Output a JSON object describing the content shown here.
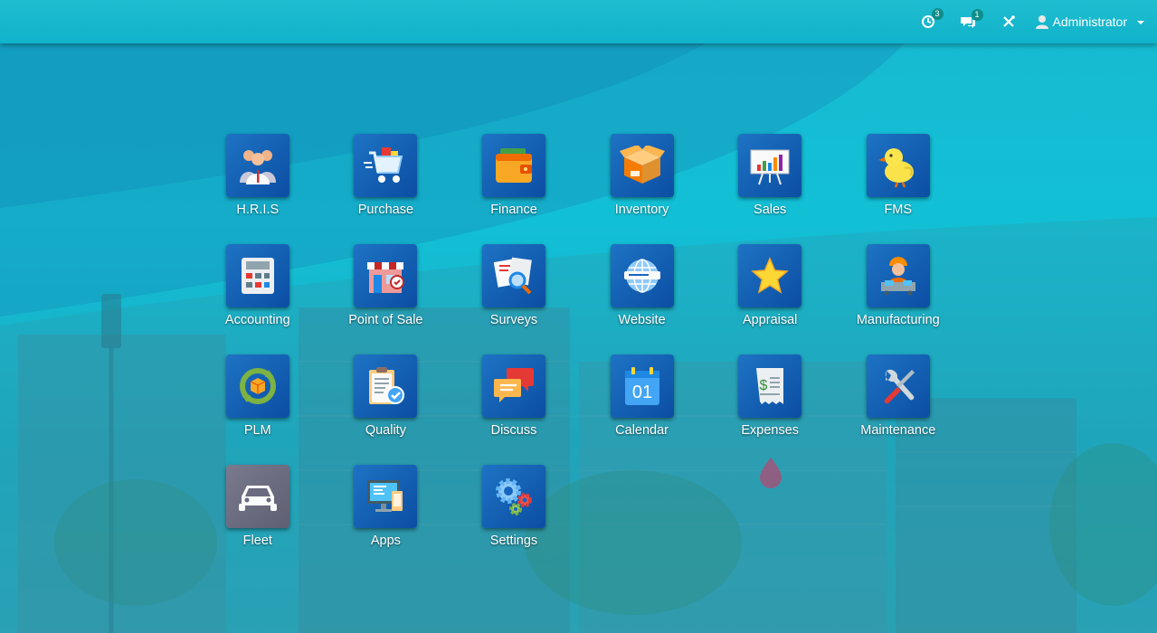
{
  "topbar": {
    "activity_count": "3",
    "messages_count": "1",
    "user_name": "Administrator"
  },
  "apps": [
    {
      "label": "H.R.I.S",
      "icon": "people-icon"
    },
    {
      "label": "Purchase",
      "icon": "shopping-cart-icon"
    },
    {
      "label": "Finance",
      "icon": "wallet-icon"
    },
    {
      "label": "Inventory",
      "icon": "box-icon"
    },
    {
      "label": "Sales",
      "icon": "presentation-chart-icon"
    },
    {
      "label": "FMS",
      "icon": "chick-icon"
    },
    {
      "label": "Accounting",
      "icon": "calculator-icon"
    },
    {
      "label": "Point of Sale",
      "icon": "store-icon"
    },
    {
      "label": "Surveys",
      "icon": "survey-icon"
    },
    {
      "label": "Website",
      "icon": "globe-icon"
    },
    {
      "label": "Appraisal",
      "icon": "star-icon"
    },
    {
      "label": "Manufacturing",
      "icon": "worker-icon"
    },
    {
      "label": "PLM",
      "icon": "cycle-icon"
    },
    {
      "label": "Quality",
      "icon": "clipboard-check-icon"
    },
    {
      "label": "Discuss",
      "icon": "chat-bubbles-icon"
    },
    {
      "label": "Calendar",
      "icon": "calendar-icon",
      "calendar_day": "01"
    },
    {
      "label": "Expenses",
      "icon": "receipt-icon"
    },
    {
      "label": "Maintenance",
      "icon": "tools-icon"
    },
    {
      "label": "Fleet",
      "icon": "car-icon"
    },
    {
      "label": "Apps",
      "icon": "monitor-icon"
    },
    {
      "label": "Settings",
      "icon": "gears-icon"
    }
  ],
  "colors": {
    "icon_bg": "#1565c0",
    "fleet_bg": "#6b6b80",
    "topbar": "#14b8ce"
  }
}
